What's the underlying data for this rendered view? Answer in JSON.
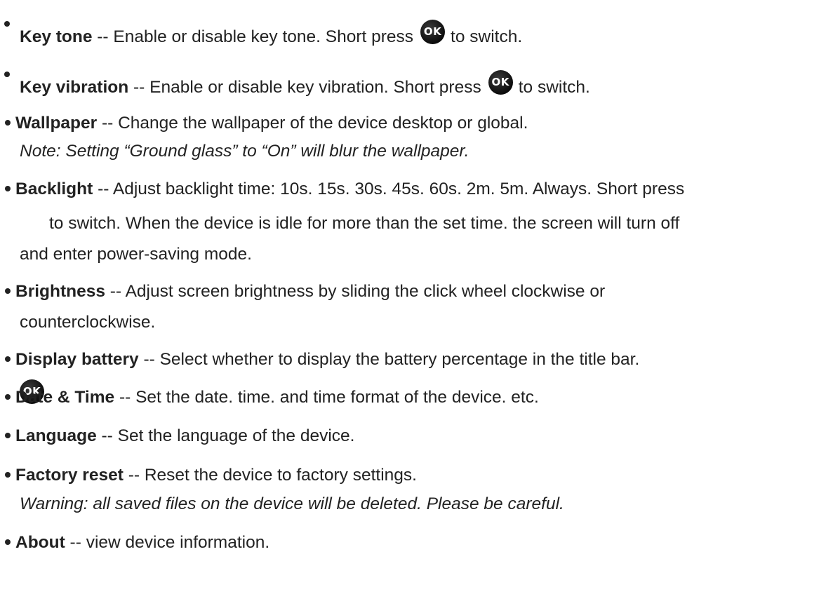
{
  "ok_icon": {
    "label": "OK",
    "icon": "ok-button-icon",
    "color": "#111111"
  },
  "items": {
    "key_tone": {
      "term": "Key tone",
      "sep": " -- ",
      "text": "Enable or disable key tone. Short press",
      "after": "to switch."
    },
    "key_vibration": {
      "term": "Key vibration",
      "sep": " -- ",
      "text": "Enable or disable key vibration. Short press",
      "after": "to switch."
    },
    "wallpaper": {
      "term": "Wallpaper",
      "sep": " -- ",
      "text": "Change the wallpaper of the device desktop or global.",
      "note": "Note: Setting “Ground glass” to “On” will blur the wallpaper."
    },
    "backlight": {
      "term": "Backlight",
      "sep": " -- ",
      "text": "Adjust backlight time: 10s. 15s. 30s. 45s. 60s. 2m. 5m. Always. Short press",
      "line2": "to switch. When the device is idle for more than the set time. the screen will turn off",
      "line3": "and enter power-saving mode."
    },
    "brightness": {
      "term": "Brightness",
      "sep": " -- ",
      "text": "Adjust screen brightness by sliding the click wheel clockwise or",
      "line2": "counterclockwise."
    },
    "display_battery": {
      "term": "Display battery",
      "sep": " -- ",
      "text": "Select whether to display the battery percentage in the title bar."
    },
    "date_time": {
      "term": "Date & Time",
      "sep": " -- ",
      "text": "Set the date. time. and time format of the device. etc."
    },
    "language": {
      "term": "Language",
      "sep": " -- ",
      "text": "Set the language of the device."
    },
    "factory_reset": {
      "term": "Factory reset",
      "sep": " -- ",
      "text": "Reset the device to factory settings.",
      "note": "Warning: all saved files on the device will be deleted. Please be careful."
    },
    "about": {
      "term": "About",
      "sep": " -- ",
      "text": "view device information."
    }
  }
}
